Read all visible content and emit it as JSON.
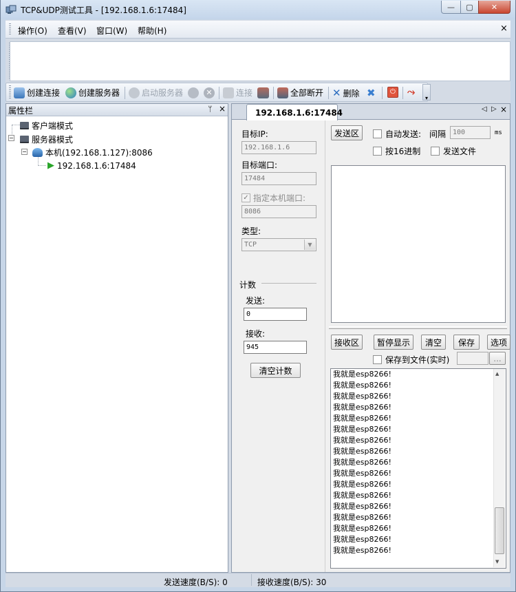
{
  "window": {
    "title": "TCP&UDP测试工具 - [192.168.1.6:17484]",
    "min_glyph": "—",
    "max_glyph": "▢",
    "close_glyph": "✕"
  },
  "menu": {
    "items": [
      "操作(O)",
      "查看(V)",
      "窗口(W)",
      "帮助(H)"
    ],
    "close_glyph": "×"
  },
  "toolbar": {
    "create_connection": "创建连接",
    "create_server": "创建服务器",
    "start_server": "启动服务器",
    "connect": "连接",
    "disconnect_all": "全部断开",
    "delete": "删除"
  },
  "left_panel": {
    "title": "属性栏",
    "pin_glyph": "ᛘ",
    "close_glyph": "×",
    "tree": {
      "client_mode": "客户端模式",
      "server_mode": "服务器模式",
      "local_host": "本机(192.168.1.127):8086",
      "remote_peer": "192.168.1.6:17484",
      "expand_glyph": "−"
    }
  },
  "tab": {
    "label": "192.168.1.6:17484",
    "prev_glyph": "◁",
    "next_glyph": "▷",
    "close_glyph": "×"
  },
  "settings": {
    "target_ip_label": "目标IP:",
    "target_ip_value": "192.168.1.6",
    "target_port_label": "目标端口:",
    "target_port_value": "17484",
    "local_port_check_label": "指定本机端口:",
    "local_port_value": "8086",
    "type_label": "类型:",
    "type_value": "TCP",
    "count_group": "计数",
    "send_label": "发送:",
    "send_value": "0",
    "recv_label": "接收:",
    "recv_value": "945",
    "clear_count_button": "清空计数"
  },
  "send_area": {
    "button": "发送区",
    "auto_send_label": "自动发送:",
    "interval_label": "间隔",
    "interval_value": "100",
    "interval_unit": "ms",
    "hex_label": "按16进制",
    "send_file_label": "发送文件"
  },
  "recv_area": {
    "button": "接收区",
    "pause_button": "暂停显示",
    "clear_button": "清空",
    "save_button": "保存",
    "options_button": "选项",
    "save_realtime_label": "保存到文件(实时)",
    "browse_button": "...",
    "lines": [
      "我就是esp8266!",
      "我就是esp8266!",
      "我就是esp8266!",
      "我就是esp8266!",
      "我就是esp8266!",
      "我就是esp8266!",
      "我就是esp8266!",
      "我就是esp8266!",
      "我就是esp8266!",
      "我就是esp8266!",
      "我就是esp8266!",
      "我就是esp8266!",
      "我就是esp8266!",
      "我就是esp8266!",
      "我就是esp8266!",
      "我就是esp8266!",
      "我就是esp8266!"
    ],
    "scroll_up_glyph": "▲",
    "scroll_down_glyph": "▼"
  },
  "status": {
    "send_speed": "发送速度(B/S): 0",
    "recv_speed": "接收速度(B/S): 30"
  }
}
